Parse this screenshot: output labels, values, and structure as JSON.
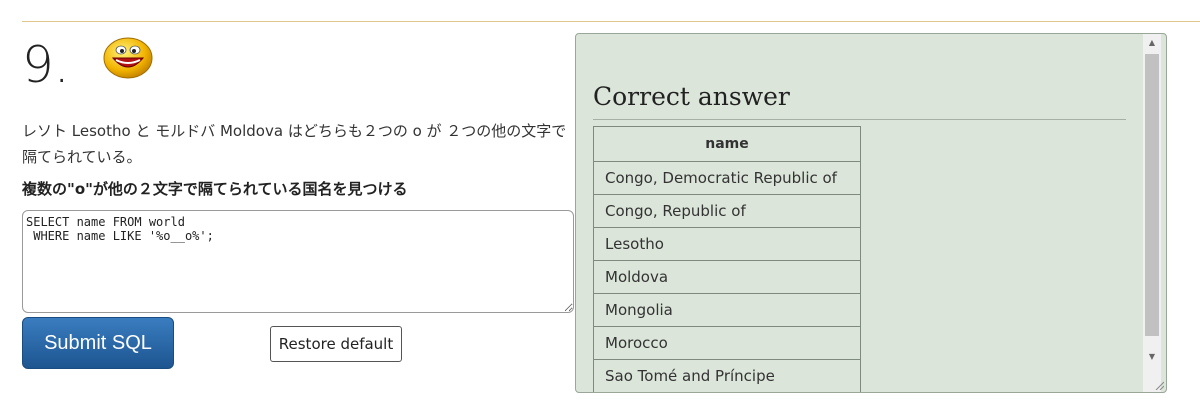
{
  "question": {
    "number": "9.",
    "description_prefix": "レソト ",
    "lesotho": "Lesotho",
    "description_mid": " と モルドバ ",
    "moldova": "Moldova",
    "description_suffix": " はどちらも２つの o が ２つの他の文字で隔てられている。",
    "task": "複数の\"o\"が他の２文字で隔てられている国名を見つける"
  },
  "editor": {
    "sql": "SELECT name FROM world\n WHERE name LIKE '%o__o%';"
  },
  "buttons": {
    "submit_label": "Submit SQL",
    "restore_label": "Restore default"
  },
  "answer": {
    "title": "Correct answer",
    "column_header": "name",
    "rows": [
      "Congo, Democratic Republic of",
      "Congo, Republic of",
      "Lesotho",
      "Moldova",
      "Mongolia",
      "Morocco",
      "Sao Tomé and Príncipe"
    ]
  },
  "icons": {
    "smiley": "smiley-face-icon"
  },
  "colors": {
    "panel_bg": "#dbe5d9",
    "submit_bg": "#2a6aa8",
    "top_rule": "#e2c58c"
  }
}
